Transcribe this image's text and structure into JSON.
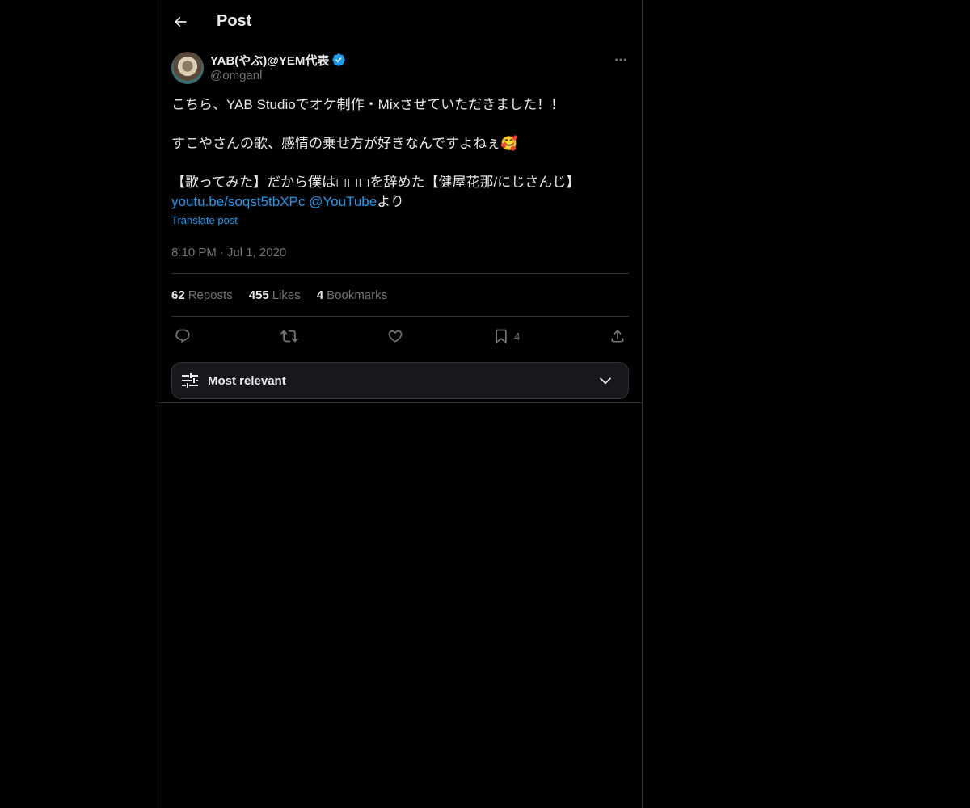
{
  "header": {
    "title": "Post"
  },
  "author": {
    "display_name": "YAB(やぶ)@YEM代表",
    "handle": "@omganl",
    "verified": true
  },
  "post": {
    "line1": "こちら、YAB Studioでオケ制作・Mixさせていただきました！！",
    "line2": "すこやさんの歌、感情の乗せ方が好きなんですよねぇ🥰",
    "line3": "【歌ってみた】だから僕は◻︎◻︎◻︎を辞めた【健屋花那/にじさんじ】",
    "link_url": "youtu.be/soqst5tbXPc",
    "mention": "@YouTube",
    "suffix": "より",
    "translate_label": "Translate post",
    "time": "8:10 PM",
    "separator": "·",
    "date": "Jul 1, 2020"
  },
  "stats": {
    "reposts_count": "62",
    "reposts_label": "Reposts",
    "likes_count": "455",
    "likes_label": "Likes",
    "bookmarks_count": "4",
    "bookmarks_label": "Bookmarks"
  },
  "actions": {
    "bookmark_count": "4"
  },
  "sort": {
    "label": "Most relevant"
  },
  "colors": {
    "background": "#000000",
    "accent": "#1d9bf0",
    "text_primary": "#e7e9ea",
    "text_secondary": "#71767b",
    "border": "#2f3336"
  },
  "icons": [
    "back-arrow-icon",
    "verified-badge-icon",
    "more-icon",
    "reply-icon",
    "repost-icon",
    "like-icon",
    "bookmark-icon",
    "share-icon",
    "sort-sliders-icon",
    "chevron-down-icon"
  ]
}
